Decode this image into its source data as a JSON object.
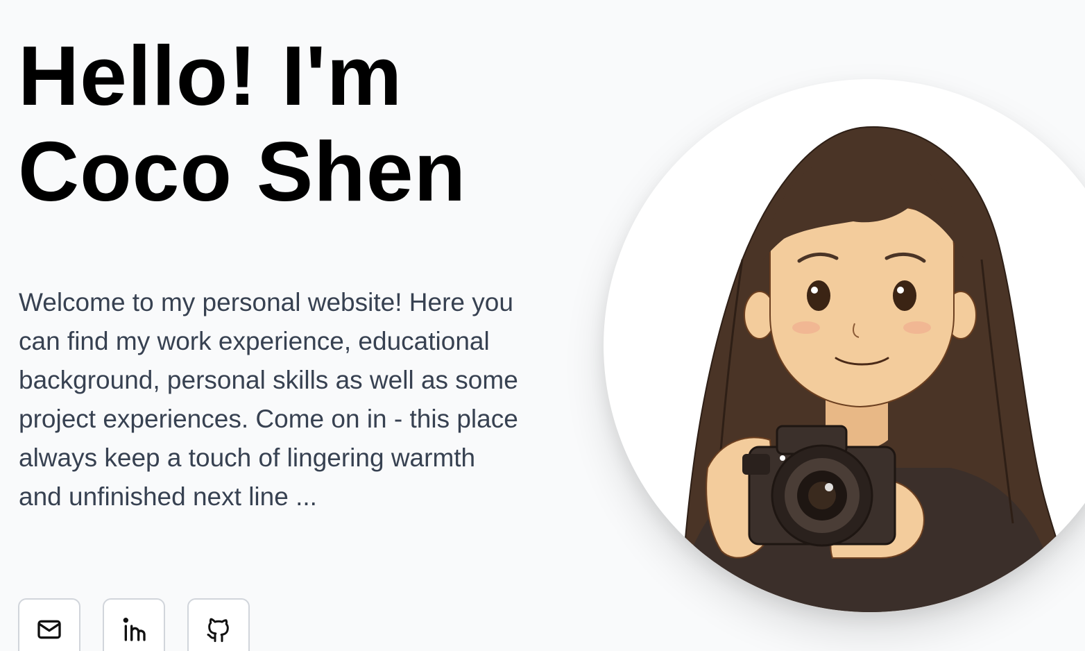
{
  "hero": {
    "title_line1": "Hello! I'm",
    "title_line2": "Coco Shen",
    "intro": "Welcome to my personal website! Here you can find my work experience, educational background, personal skills as well as some project experiences. Come on in - this place always keep a touch of lingering warmth and unfinished next line ..."
  },
  "social": [
    {
      "icon": "mail-icon"
    },
    {
      "icon": "linkedin-icon"
    },
    {
      "icon": "github-icon"
    }
  ],
  "avatar": {
    "description_icon": "girl-with-camera-illustration"
  },
  "colors": {
    "background": "#f9fafb",
    "title": "#000000",
    "intro": "#374151",
    "button_border": "#d1d5db",
    "hair": "#4a3426",
    "skin": "#f3cc9c",
    "shirt": "#3b2f2a"
  }
}
